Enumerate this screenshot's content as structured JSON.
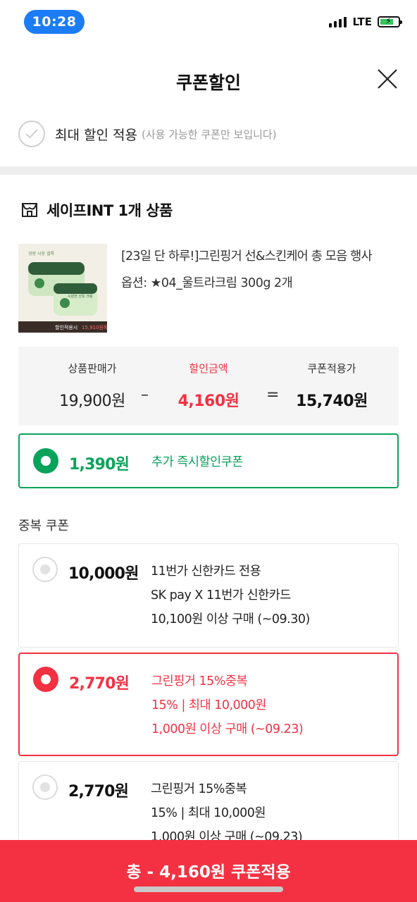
{
  "status": {
    "time": "10:28",
    "network": "LTE"
  },
  "header": {
    "title": "쿠폰할인"
  },
  "max_discount": {
    "label": "최대 할인 적용",
    "hint": "(사용 가능한 쿠폰만 보입니다)"
  },
  "seller": {
    "name": "세이프INT 1개 상품"
  },
  "product": {
    "title": "[23일 단 하루!]그린핑거 선&스킨케어 총 모음 행사",
    "option": "옵션: ★04_울트라크림 300g 2개",
    "image_text": {
      "top": "경량 사용 겔룩",
      "top2": "시원한 산뜻 크림",
      "bottom": "할인적용시",
      "price": "15,910원혜택가"
    }
  },
  "prices": {
    "sale_label": "상품판매가",
    "sale_value": "19,900원",
    "discount_label": "할인금액",
    "discount_value": "4,160원",
    "final_label": "쿠폰적용가",
    "final_value": "15,740원",
    "minus": "–",
    "equals": "="
  },
  "instant_coupon": {
    "amount": "1,390원",
    "label": "추가 즉시할인쿠폰",
    "selected": true
  },
  "duplicate_section": {
    "label": "중복 쿠폰"
  },
  "coupons": [
    {
      "amount": "10,000원",
      "lines": [
        "11번가 신한카드 전용",
        "SK pay X 11번가 신한카드",
        "10,100원 이상 구매 (~09.30)"
      ],
      "selected": false
    },
    {
      "amount": "2,770원",
      "lines": [
        "그린핑거 15%중복",
        "15% | 최대 10,000원",
        "1,000원 이상 구매 (~09.23)"
      ],
      "selected": true
    },
    {
      "amount": "2,770원",
      "lines": [
        "그린핑거 15%중복",
        "15% | 최대 10,000원",
        "1,000원 이상 구매 (~09.23)"
      ],
      "selected": false
    }
  ],
  "apply_button": {
    "label": "총 - 4,160원 쿠폰적용"
  },
  "colors": {
    "accent_red": "#f43142",
    "accent_green": "#0aa35b",
    "time_pill": "#1c7cf5"
  }
}
